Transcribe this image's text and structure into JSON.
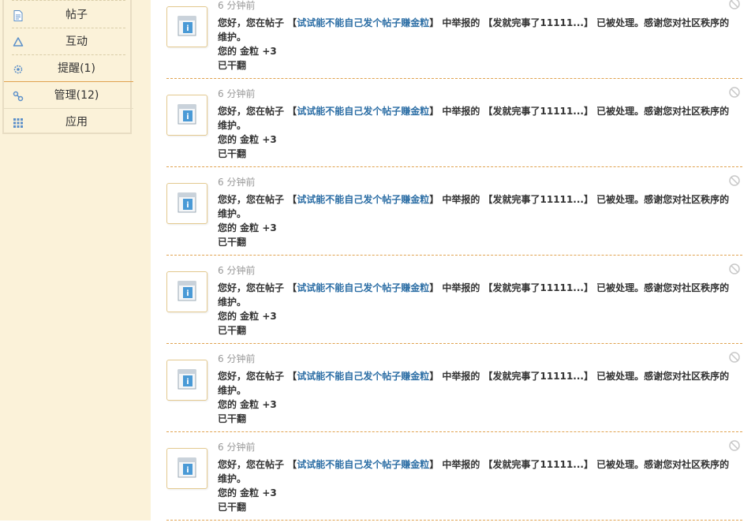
{
  "sidebar": {
    "items": [
      {
        "label": "帖子",
        "icon": "document-icon"
      },
      {
        "label": "互动",
        "icon": "recycle-icon"
      },
      {
        "label": "提醒(1)",
        "icon": "gear-icon"
      },
      {
        "label": "管理(12)",
        "icon": "link-icon"
      },
      {
        "label": "应用",
        "icon": "grid-icon"
      }
    ]
  },
  "feed": {
    "items": [
      {
        "time": "6 分钟前",
        "prefix": "您好，您在帖子 【",
        "thread_link": "试试能不能自己发个帖子赚金粒",
        "suffix": "】 中举报的 【发就完事了11111...】 已被处理。感谢您对社区秩序的维护。",
        "reward_label": "您的 金粒 +3",
        "status": "已干翻"
      },
      {
        "time": "6 分钟前",
        "prefix": "您好，您在帖子 【",
        "thread_link": "试试能不能自己发个帖子赚金粒",
        "suffix": "】 中举报的 【发就完事了11111...】 已被处理。感谢您对社区秩序的维护。",
        "reward_label": "您的 金粒 +3",
        "status": "已干翻"
      },
      {
        "time": "6 分钟前",
        "prefix": "您好，您在帖子 【",
        "thread_link": "试试能不能自己发个帖子赚金粒",
        "suffix": "】 中举报的 【发就完事了11111...】 已被处理。感谢您对社区秩序的维护。",
        "reward_label": "您的 金粒 +3",
        "status": "已干翻"
      },
      {
        "time": "6 分钟前",
        "prefix": "您好，您在帖子 【",
        "thread_link": "试试能不能自己发个帖子赚金粒",
        "suffix": "】 中举报的 【发就完事了11111...】 已被处理。感谢您对社区秩序的维护。",
        "reward_label": "您的 金粒 +3",
        "status": "已干翻"
      },
      {
        "time": "6 分钟前",
        "prefix": "您好，您在帖子 【",
        "thread_link": "试试能不能自己发个帖子赚金粒",
        "suffix": "】 中举报的 【发就完事了11111...】 已被处理。感谢您对社区秩序的维护。",
        "reward_label": "您的 金粒 +3",
        "status": "已干翻"
      },
      {
        "time": "6 分钟前",
        "prefix": "您好，您在帖子 【",
        "thread_link": "试试能不能自己发个帖子赚金粒",
        "suffix": "】 中举报的 【发就完事了11111...】 已被处理。感谢您对社区秩序的维护。",
        "reward_label": "您的 金粒 +3",
        "status": "已干翻"
      }
    ]
  },
  "colors": {
    "sidebar_bg": "#fbf2d9",
    "link": "#2c6ea5",
    "divider": "#e0a24f",
    "icon_blue": "#5b8fc9"
  }
}
